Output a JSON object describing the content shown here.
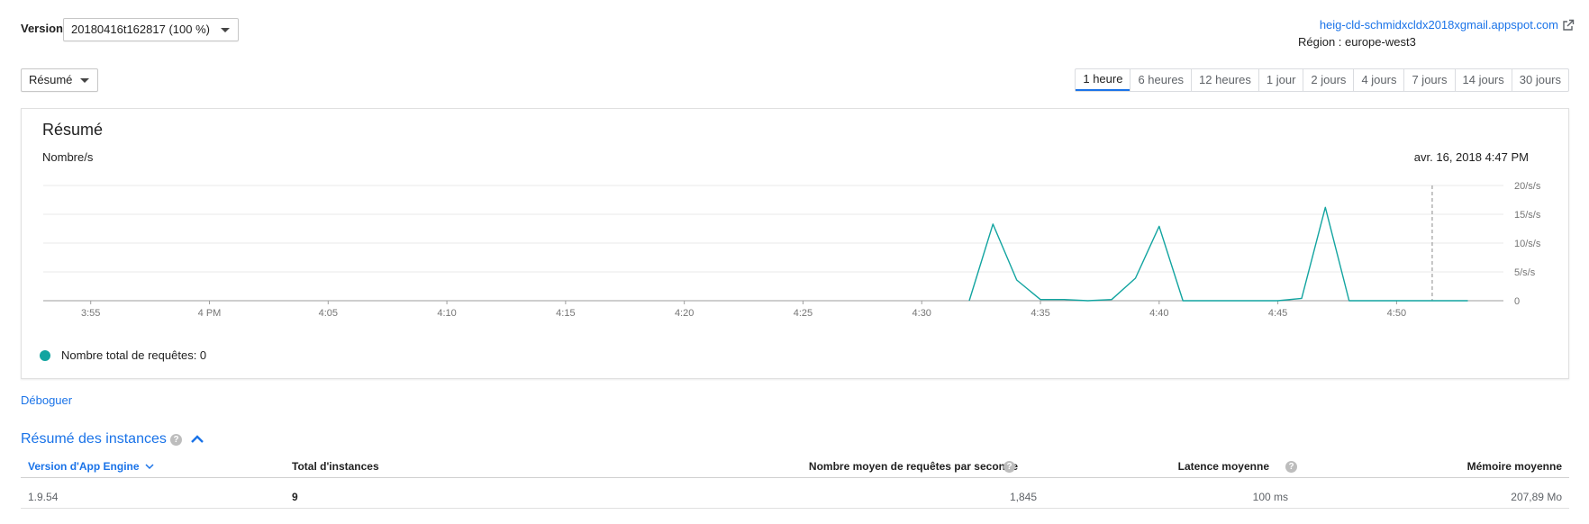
{
  "header": {
    "version_label": "Version",
    "version_value": "20180416t162817 (100 %)",
    "app_url": "heig-cld-schmidxcldx2018xgmail.appspot.com",
    "region": "Région : europe-west3",
    "external_icon": "external-link-icon"
  },
  "view_select": {
    "value": "Résumé"
  },
  "time_range": {
    "options": [
      "1 heure",
      "6 heures",
      "12 heures",
      "1 jour",
      "2 jours",
      "4 jours",
      "7 jours",
      "14 jours",
      "30 jours"
    ],
    "selected": "1 heure"
  },
  "summary_card": {
    "title": "Résumé",
    "y_unit": "Nombre/s",
    "timestamp": "avr. 16, 2018 4:47 PM",
    "legend_label": "Nombre total de requêtes: 0"
  },
  "chart_data": {
    "type": "line",
    "x_tick_labels": [
      "3:55",
      "4 PM",
      "4:05",
      "4:10",
      "4:15",
      "4:20",
      "4:25",
      "4:30",
      "4:35",
      "4:40",
      "4:45",
      "4:50"
    ],
    "y_tick_labels": [
      "20/s/s",
      "15/s/s",
      "10/s/s",
      "5/s/s",
      "0"
    ],
    "ylim": [
      0,
      20
    ],
    "xlim_minutes": [
      3.0,
      64.5
    ],
    "cursor_minute": 61.5,
    "series": [
      {
        "color": "#12a4a0",
        "x_minutes": [
          42,
          43,
          44,
          45,
          46,
          47,
          48,
          49,
          50,
          51,
          52,
          53,
          54,
          55,
          56,
          57,
          58,
          59,
          60,
          61,
          62,
          63
        ],
        "y": [
          0,
          13.3,
          3.6,
          0.2,
          0.2,
          0,
          0.2,
          3.9,
          12.9,
          0,
          0,
          0,
          0,
          0,
          0.4,
          16.2,
          0,
          0,
          0,
          0,
          0,
          0
        ]
      }
    ]
  },
  "debug_link": "Déboguer",
  "instances": {
    "title": "Résumé des instances",
    "headers": {
      "version": "Version d'App Engine",
      "total": "Total d'instances",
      "avg_requests": "Nombre moyen de requêtes par seconde",
      "avg_latency": "Latence moyenne",
      "avg_memory": "Mémoire moyenne"
    },
    "row": {
      "version": "1.9.54",
      "total": "9",
      "avg_requests": "1,845",
      "avg_latency": "100 ms",
      "avg_memory": "207,89 Mo"
    }
  }
}
